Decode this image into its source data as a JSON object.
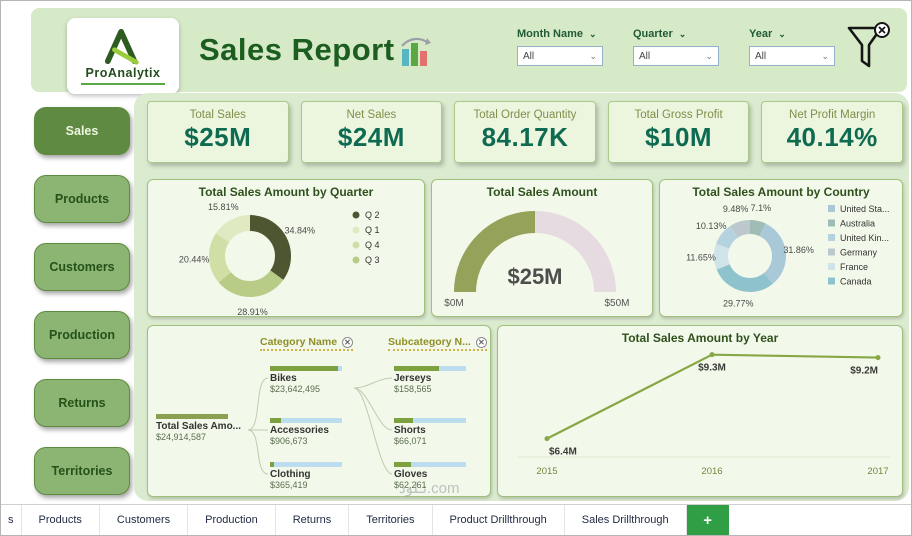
{
  "page": {
    "watermark": "نـلود.com"
  },
  "header": {
    "logo": {
      "name": "ProAnalytix"
    },
    "title": "Sales Report",
    "filters": [
      {
        "label": "Month Name",
        "value": "All"
      },
      {
        "label": "Quarter",
        "value": "All"
      },
      {
        "label": "Year",
        "value": "All"
      }
    ]
  },
  "sidebar": {
    "items": [
      {
        "label": "Sales",
        "active": true
      },
      {
        "label": "Products",
        "active": false
      },
      {
        "label": "Customers",
        "active": false
      },
      {
        "label": "Production",
        "active": false
      },
      {
        "label": "Returns",
        "active": false
      },
      {
        "label": "Territories",
        "active": false
      }
    ]
  },
  "kpis": [
    {
      "label": "Total Sales",
      "value": "$25M"
    },
    {
      "label": "Net Sales",
      "value": "$24M"
    },
    {
      "label": "Total Order Quantity",
      "value": "84.17K"
    },
    {
      "label": "Total Gross Profit",
      "value": "$10M"
    },
    {
      "label": "Net Profit Margin",
      "value": "40.14%"
    }
  ],
  "chart_data": [
    {
      "id": "quarter_donut",
      "type": "pie",
      "title": "Total Sales Amount by Quarter",
      "slices": [
        {
          "label": "Q 2",
          "pct": 34.84,
          "pct_label": "34.84%",
          "color": "#4e5631"
        },
        {
          "label": "Q 3",
          "pct": 28.91,
          "pct_label": "28.91%",
          "color": "#b8cc87"
        },
        {
          "label": "Q 4",
          "pct": 20.44,
          "pct_label": "20.44%",
          "color": "#cfdfa6"
        },
        {
          "label": "Q 1",
          "pct": 15.81,
          "pct_label": "15.81%",
          "color": "#dfeac2"
        }
      ],
      "legend": [
        {
          "label": "Q 2",
          "color": "#4e5631"
        },
        {
          "label": "Q 1",
          "color": "#dfeac2"
        },
        {
          "label": "Q 4",
          "color": "#cfdfa6"
        },
        {
          "label": "Q 3",
          "color": "#b8cc87"
        }
      ]
    },
    {
      "id": "sales_gauge",
      "type": "gauge",
      "title": "Total Sales Amount",
      "value": 25,
      "min": 0,
      "max": 50,
      "value_label": "$25M",
      "min_label": "$0M",
      "max_label": "$50M",
      "fill_color": "#95a259",
      "track_color": "#e5dbe1"
    },
    {
      "id": "country_donut",
      "type": "pie",
      "title": "Total Sales Amount by Country",
      "slices": [
        {
          "label": "Australia",
          "pct": 7.1,
          "pct_label": "7.1%",
          "color": "#9fbdb4"
        },
        {
          "label": "United Sta...",
          "pct": 31.86,
          "pct_label": "31.86%",
          "color": "#a9c8d8"
        },
        {
          "label": "Canada",
          "pct": 29.77,
          "pct_label": "29.77%",
          "color": "#8ec2cd"
        },
        {
          "label": "France",
          "pct": 11.65,
          "pct_label": "11.65%",
          "color": "#cfe3e9"
        },
        {
          "label": "United Kin...",
          "pct": 10.13,
          "pct_label": "10.13%",
          "color": "#b5d3df"
        },
        {
          "label": "Germany",
          "pct": 9.48,
          "pct_label": "9.48%",
          "color": "#bcc8ce"
        }
      ],
      "legend": [
        {
          "label": "United Sta...",
          "color": "#a9c8d8"
        },
        {
          "label": "Australia",
          "color": "#9fbdb4"
        },
        {
          "label": "United Kin...",
          "color": "#b5d3df"
        },
        {
          "label": "Germany",
          "color": "#bcc8ce"
        },
        {
          "label": "France",
          "color": "#cfe3e9"
        },
        {
          "label": "Canada",
          "color": "#8ec2cd"
        }
      ]
    },
    {
      "id": "decomposition_tree",
      "type": "tree",
      "column_headers": [
        {
          "label": "Category Name"
        },
        {
          "label": "Subcategory N..."
        }
      ],
      "root": {
        "label": "Total Sales Amo...",
        "value": "$24,914,587",
        "fraction": 1
      },
      "categories": [
        {
          "label": "Bikes",
          "value": "$23,642,495",
          "fraction": 0.95
        },
        {
          "label": "Accessories",
          "value": "$906,673",
          "fraction": 0.15
        },
        {
          "label": "Clothing",
          "value": "$365,419",
          "fraction": 0.06
        }
      ],
      "subcategories": [
        {
          "label": "Jerseys",
          "value": "$158,565",
          "fraction": 0.62
        },
        {
          "label": "Shorts",
          "value": "$66,071",
          "fraction": 0.26
        },
        {
          "label": "Gloves",
          "value": "$62,261",
          "fraction": 0.24
        }
      ]
    },
    {
      "id": "year_line",
      "type": "line",
      "title": "Total Sales Amount by Year",
      "x": [
        "2015",
        "2016",
        "2017"
      ],
      "values": [
        6.4,
        9.3,
        9.2
      ],
      "point_labels": [
        "$6.4M",
        "$9.3M",
        "$9.2M"
      ],
      "ylim": [
        5.8,
        9.6
      ],
      "line_color": "#86a743"
    }
  ],
  "tabs": {
    "items": [
      "s",
      "Products",
      "Customers",
      "Production",
      "Returns",
      "Territories",
      "Product Drillthrough",
      "Sales Drillthrough"
    ],
    "add_label": "+"
  }
}
